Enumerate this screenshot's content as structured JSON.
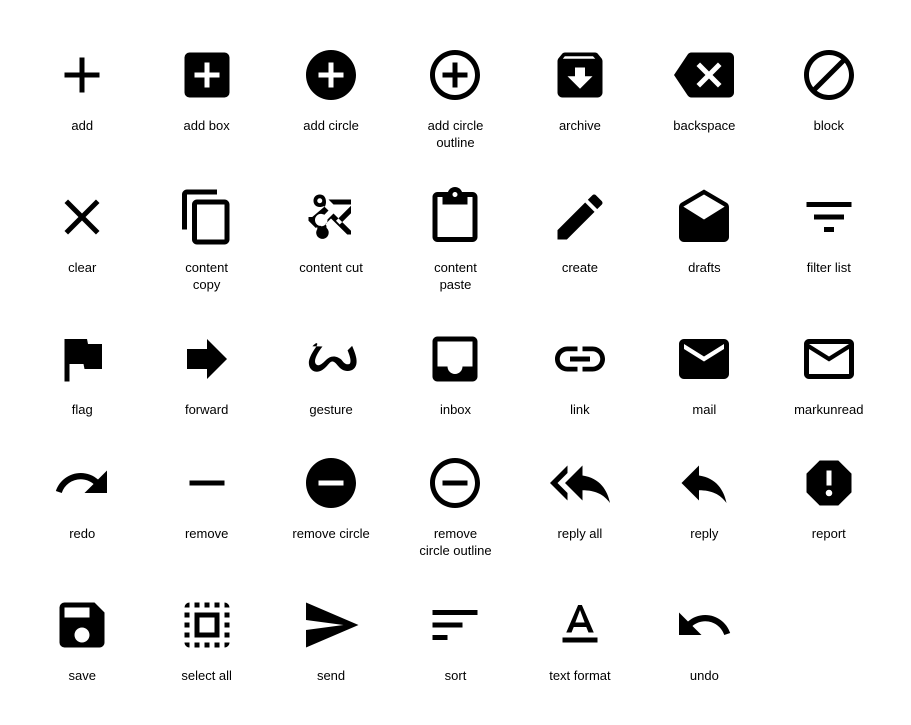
{
  "icons": [
    {
      "id": "add",
      "label": "add"
    },
    {
      "id": "add-box",
      "label": "add box"
    },
    {
      "id": "add-circle",
      "label": "add circle"
    },
    {
      "id": "add-circle-outline",
      "label": "add circle\noutline"
    },
    {
      "id": "archive",
      "label": "archive"
    },
    {
      "id": "backspace",
      "label": "backspace"
    },
    {
      "id": "block",
      "label": "block"
    },
    {
      "id": "clear",
      "label": "clear"
    },
    {
      "id": "content-copy",
      "label": "content\ncopy"
    },
    {
      "id": "content-cut",
      "label": "content cut"
    },
    {
      "id": "content-paste",
      "label": "content\npaste"
    },
    {
      "id": "create",
      "label": "create"
    },
    {
      "id": "drafts",
      "label": "drafts"
    },
    {
      "id": "filter-list",
      "label": "filter list"
    },
    {
      "id": "flag",
      "label": "flag"
    },
    {
      "id": "forward",
      "label": "forward"
    },
    {
      "id": "gesture",
      "label": "gesture"
    },
    {
      "id": "inbox",
      "label": "inbox"
    },
    {
      "id": "link",
      "label": "link"
    },
    {
      "id": "mail",
      "label": "mail"
    },
    {
      "id": "markunread",
      "label": "markunread"
    },
    {
      "id": "redo",
      "label": "redo"
    },
    {
      "id": "remove",
      "label": "remove"
    },
    {
      "id": "remove-circle",
      "label": "remove circle"
    },
    {
      "id": "remove-circle-outline",
      "label": "remove\ncircle outline"
    },
    {
      "id": "reply-all",
      "label": "reply all"
    },
    {
      "id": "reply",
      "label": "reply"
    },
    {
      "id": "report",
      "label": "report"
    },
    {
      "id": "save",
      "label": "save"
    },
    {
      "id": "select-all",
      "label": "select all"
    },
    {
      "id": "send",
      "label": "send"
    },
    {
      "id": "sort",
      "label": "sort"
    },
    {
      "id": "text-format",
      "label": "text format"
    },
    {
      "id": "undo",
      "label": "undo"
    }
  ]
}
